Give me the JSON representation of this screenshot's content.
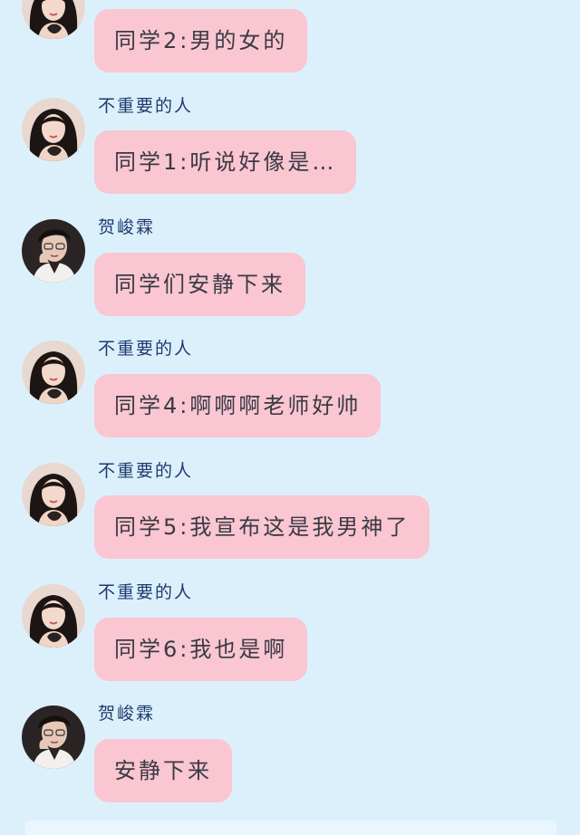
{
  "messages": [
    {
      "sender": "",
      "text": "同学2:男的女的",
      "avatar_icon": "girl-avatar"
    },
    {
      "sender": "不重要的人",
      "text": "同学1:听说好像是…",
      "avatar_icon": "girl-avatar"
    },
    {
      "sender": "贺峻霖",
      "text": "同学们安静下来",
      "avatar_icon": "boy-avatar"
    },
    {
      "sender": "不重要的人",
      "text": "同学4:啊啊啊老师好帅",
      "avatar_icon": "girl-avatar"
    },
    {
      "sender": "不重要的人",
      "text": "同学5:我宣布这是我男神了",
      "avatar_icon": "girl-avatar"
    },
    {
      "sender": "不重要的人",
      "text": "同学6:我也是啊",
      "avatar_icon": "girl-avatar"
    },
    {
      "sender": "贺峻霖",
      "text": "安静下来",
      "avatar_icon": "boy-avatar"
    }
  ],
  "colors": {
    "background": "#dcf0fc",
    "bubble": "#f9c6d1",
    "sender_name": "#1e3a6e",
    "bubble_text": "#3a3a44"
  }
}
